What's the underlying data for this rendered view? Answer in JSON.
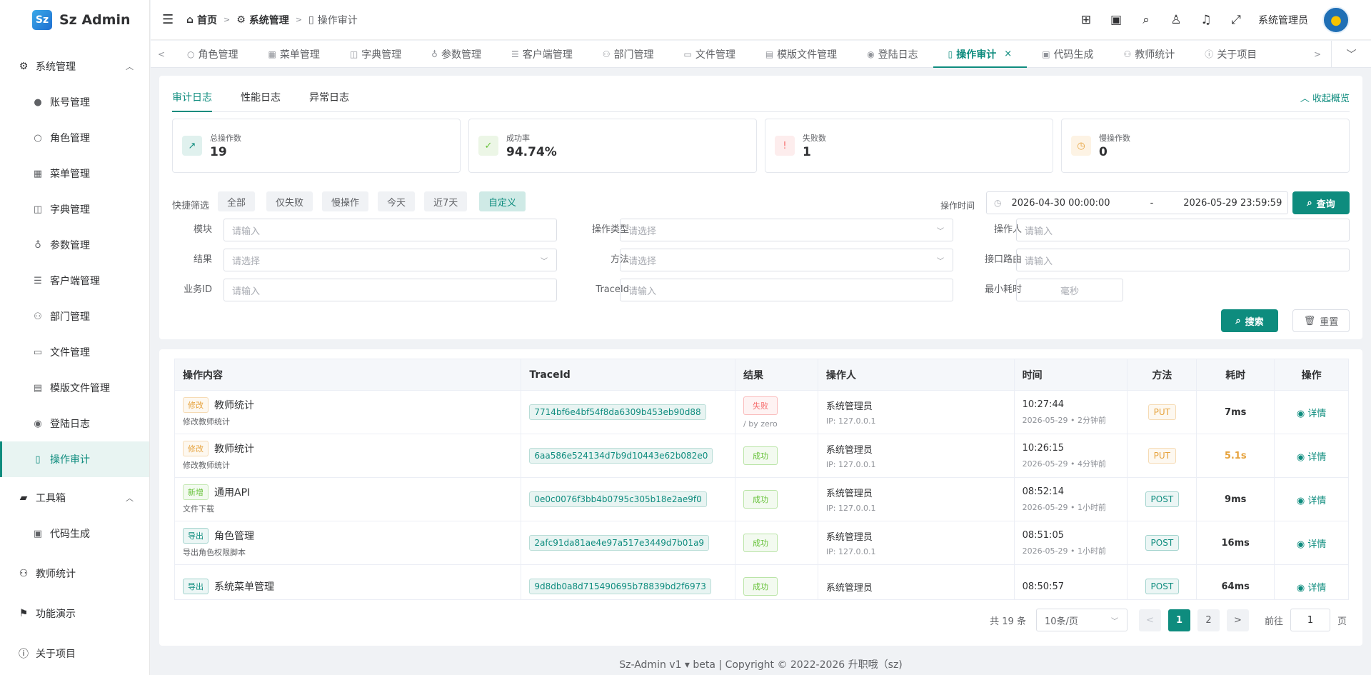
{
  "app": {
    "logo_mark": "Sz",
    "title": "Sz Admin"
  },
  "sidebar": {
    "groups": [
      {
        "label": "系统管理",
        "icon": "gear-icon"
      },
      {
        "label": "工具箱",
        "icon": "toolbox-icon"
      }
    ],
    "items": [
      {
        "label": "账号管理",
        "icon": "user-filled-icon"
      },
      {
        "label": "角色管理",
        "icon": "user-icon"
      },
      {
        "label": "菜单管理",
        "icon": "grid-icon"
      },
      {
        "label": "字典管理",
        "icon": "book-icon"
      },
      {
        "label": "参数管理",
        "icon": "param-icon"
      },
      {
        "label": "客户端管理",
        "icon": "sliders-icon"
      },
      {
        "label": "部门管理",
        "icon": "org-icon"
      },
      {
        "label": "文件管理",
        "icon": "box-icon"
      },
      {
        "label": "模版文件管理",
        "icon": "template-icon"
      },
      {
        "label": "登陆日志",
        "icon": "location-icon"
      },
      {
        "label": "操作审计",
        "icon": "document-icon"
      },
      {
        "label": "代码生成",
        "icon": "code-gen-icon"
      }
    ],
    "bottom": [
      {
        "label": "教师统计",
        "icon": "org-icon"
      },
      {
        "label": "功能演示",
        "icon": "flag-icon"
      },
      {
        "label": "关于项目",
        "icon": "info-icon"
      }
    ]
  },
  "header": {
    "breadcrumb": [
      "首页",
      "系统管理",
      "操作审计"
    ],
    "username": "系统管理员"
  },
  "tabs": [
    {
      "label": "角色管理"
    },
    {
      "label": "菜单管理"
    },
    {
      "label": "字典管理"
    },
    {
      "label": "参数管理"
    },
    {
      "label": "客户端管理"
    },
    {
      "label": "部门管理"
    },
    {
      "label": "文件管理"
    },
    {
      "label": "模版文件管理"
    },
    {
      "label": "登陆日志"
    },
    {
      "label": "操作审计"
    },
    {
      "label": "代码生成"
    },
    {
      "label": "教师统计"
    },
    {
      "label": "关于项目"
    }
  ],
  "subtabs": [
    "审计日志",
    "性能日志",
    "异常日志"
  ],
  "collapse_label": "收起概览",
  "stats": [
    {
      "label": "总操作数",
      "value": "19"
    },
    {
      "label": "成功率",
      "value": "94.74%"
    },
    {
      "label": "失败数",
      "value": "1"
    },
    {
      "label": "慢操作数",
      "value": "0"
    }
  ],
  "quick_filter": {
    "label": "快捷筛选",
    "options": [
      "全部",
      "仅失败",
      "慢操作",
      "今天",
      "近7天",
      "自定义"
    ],
    "selected": "自定义"
  },
  "time_range": {
    "label": "操作时间",
    "start": "2026-04-30 00:00:00",
    "separator": "-",
    "end": "2026-05-29 23:59:59",
    "query_label": "查询"
  },
  "filters": {
    "module": {
      "label": "模块",
      "placeholder": "请输入"
    },
    "op_type": {
      "label": "操作类型",
      "placeholder": "请选择"
    },
    "operator": {
      "label": "操作人",
      "placeholder": "请输入"
    },
    "result": {
      "label": "结果",
      "placeholder": "请选择"
    },
    "method": {
      "label": "方法",
      "placeholder": "请选择"
    },
    "route": {
      "label": "接口路由",
      "placeholder": "请输入"
    },
    "biz_id": {
      "label": "业务ID",
      "placeholder": "请输入"
    },
    "trace_id": {
      "label": "TraceId",
      "placeholder": "请输入"
    },
    "min_cost": {
      "label": "最小耗时",
      "placeholder": "毫秒"
    },
    "search_label": "搜索",
    "reset_label": "重置"
  },
  "table": {
    "headers": [
      "操作内容",
      "TraceId",
      "结果",
      "操作人",
      "时间",
      "方法",
      "耗时",
      "操作"
    ],
    "rows": [
      {
        "tag": "修改",
        "tag_color": "#e6a23c",
        "name": "教师统计",
        "desc": "修改教师统计",
        "trace": "7714bf6e4bf54f8da6309b453eb90d88",
        "result": "失败",
        "result_color": "#f56c6c",
        "result_note": "/ by zero",
        "user": "系统管理员",
        "ip": "IP: 127.0.0.1",
        "time": "10:27:44",
        "date": "2026-05-29 • 2分钟前",
        "method": "PUT",
        "method_color": "#e6a23c",
        "cost": "7ms",
        "cost_color": "#303133",
        "action": "详情"
      },
      {
        "tag": "修改",
        "tag_color": "#e6a23c",
        "name": "教师统计",
        "desc": "修改教师统计",
        "trace": "6aa586e524134d7b9d10443e62b082e0",
        "result": "成功",
        "result_color": "#67c23a",
        "result_note": "",
        "user": "系统管理员",
        "ip": "IP: 127.0.0.1",
        "time": "10:26:15",
        "date": "2026-05-29 • 4分钟前",
        "method": "PUT",
        "method_color": "#e6a23c",
        "cost": "5.1s",
        "cost_color": "#e6a23c",
        "action": "详情"
      },
      {
        "tag": "新增",
        "tag_color": "#67c23a",
        "name": "通用API",
        "desc": "文件下载",
        "trace": "0e0c0076f3bb4b0795c305b18e2ae9f0",
        "result": "成功",
        "result_color": "#67c23a",
        "result_note": "",
        "user": "系统管理员",
        "ip": "IP: 127.0.0.1",
        "time": "08:52:14",
        "date": "2026-05-29 • 1小时前",
        "method": "POST",
        "method_color": "#0e8c7e",
        "cost": "9ms",
        "cost_color": "#303133",
        "action": "详情"
      },
      {
        "tag": "导出",
        "tag_color": "#0e8c7e",
        "name": "角色管理",
        "desc": "导出角色权限脚本",
        "trace": "2afc91da81ae4e97a517e3449d7b01a9",
        "result": "成功",
        "result_color": "#67c23a",
        "result_note": "",
        "user": "系统管理员",
        "ip": "IP: 127.0.0.1",
        "time": "08:51:05",
        "date": "2026-05-29 • 1小时前",
        "method": "POST",
        "method_color": "#0e8c7e",
        "cost": "16ms",
        "cost_color": "#303133",
        "action": "详情"
      },
      {
        "tag": "导出",
        "tag_color": "#0e8c7e",
        "name": "系统菜单管理",
        "desc": "",
        "trace": "9d8db0a8d715490695b78839bd2f6973",
        "result": "成功",
        "result_color": "#67c23a",
        "result_note": "",
        "user": "系统管理员",
        "ip": "",
        "time": "08:50:57",
        "date": "",
        "method": "POST",
        "method_color": "#0e8c7e",
        "cost": "64ms",
        "cost_color": "#303133",
        "action": "详情"
      }
    ]
  },
  "pagination": {
    "total_text": "共 19 条",
    "page_size": "10条/页",
    "pages": [
      "1",
      "2"
    ],
    "current": "1",
    "goto_label": "前往",
    "goto_value": "1",
    "page_suffix": "页"
  },
  "footer": {
    "text": "Sz-Admin v1 ▾ beta | Copyright © 2022-2026 升职哦（sz)"
  }
}
